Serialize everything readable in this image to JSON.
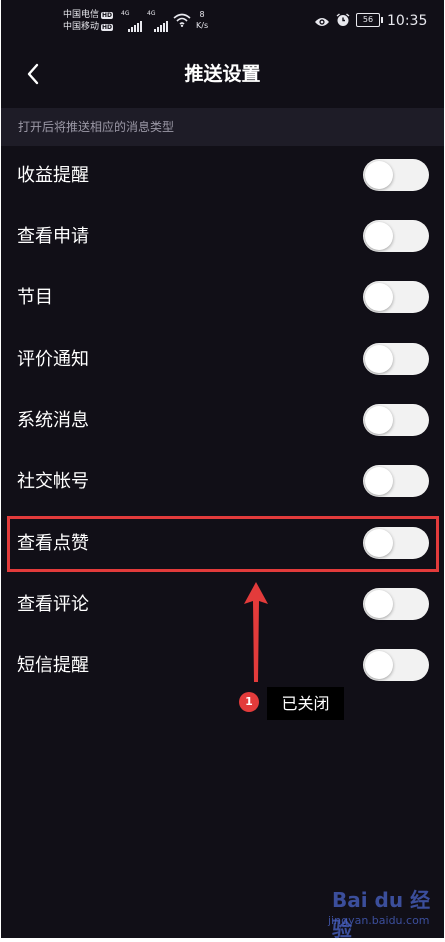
{
  "status_bar": {
    "carrier_1": "中国电信",
    "carrier_2": "中国移动",
    "hd_badge": "HD",
    "network_1": "4G",
    "network_2": "4G",
    "speed_value": "8",
    "speed_unit": "K/s",
    "battery": "56",
    "time": "10:35"
  },
  "header": {
    "title": "推送设置"
  },
  "section_hint": "打开后将推送相应的消息类型",
  "settings": [
    {
      "label": "收益提醒",
      "enabled": false
    },
    {
      "label": "查看申请",
      "enabled": false
    },
    {
      "label": "节目",
      "enabled": false
    },
    {
      "label": "评价通知",
      "enabled": false
    },
    {
      "label": "系统消息",
      "enabled": false
    },
    {
      "label": "社交帐号",
      "enabled": false
    },
    {
      "label": "查看点赞",
      "enabled": false
    },
    {
      "label": "查看评论",
      "enabled": false
    },
    {
      "label": "短信提醒",
      "enabled": false
    }
  ],
  "annotation": {
    "badge_number": "1",
    "callout_text": "已关闭",
    "color": "#e33b3b"
  },
  "watermark": {
    "logo": "Bai du 经验",
    "site": "jingyan.baidu.com"
  }
}
